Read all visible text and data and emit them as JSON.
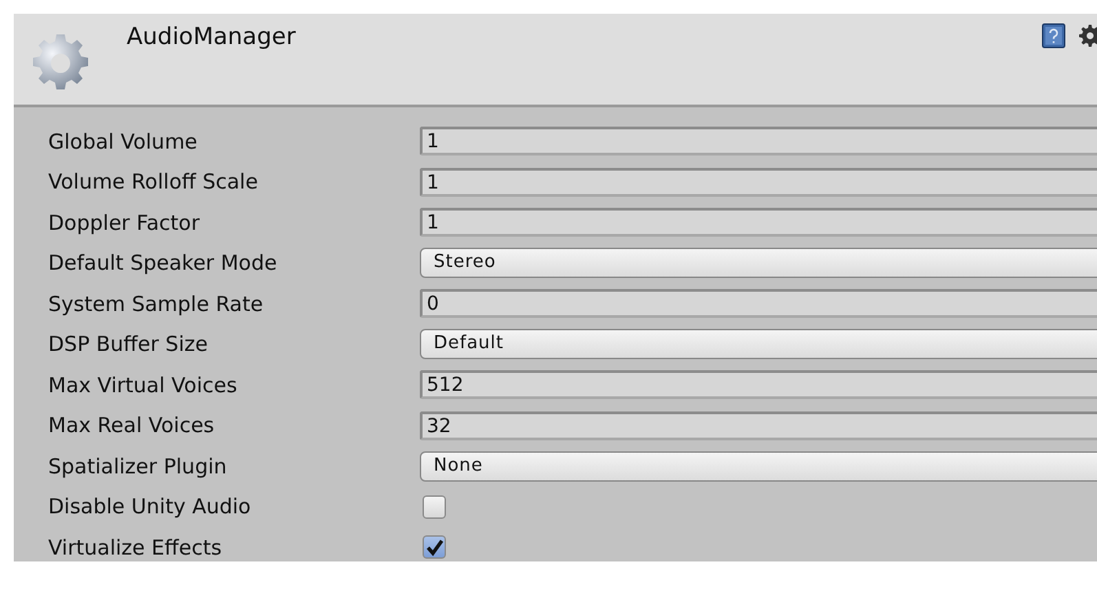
{
  "header": {
    "title": "AudioManager"
  },
  "properties": [
    {
      "label": "Global Volume",
      "kind": "number",
      "value": "1"
    },
    {
      "label": "Volume Rolloff Scale",
      "kind": "number",
      "value": "1"
    },
    {
      "label": "Doppler Factor",
      "kind": "number",
      "value": "1"
    },
    {
      "label": "Default Speaker Mode",
      "kind": "dropdown",
      "value": "Stereo"
    },
    {
      "label": "System Sample Rate",
      "kind": "number",
      "value": "0"
    },
    {
      "label": "DSP Buffer Size",
      "kind": "dropdown",
      "value": "Default"
    },
    {
      "label": "Max Virtual Voices",
      "kind": "number",
      "value": "512"
    },
    {
      "label": "Max Real Voices",
      "kind": "number",
      "value": "32"
    },
    {
      "label": "Spatializer Plugin",
      "kind": "dropdown",
      "value": "None"
    },
    {
      "label": "Disable Unity Audio",
      "kind": "checkbox",
      "checked": false
    },
    {
      "label": "Virtualize Effects",
      "kind": "checkbox",
      "checked": true
    }
  ]
}
